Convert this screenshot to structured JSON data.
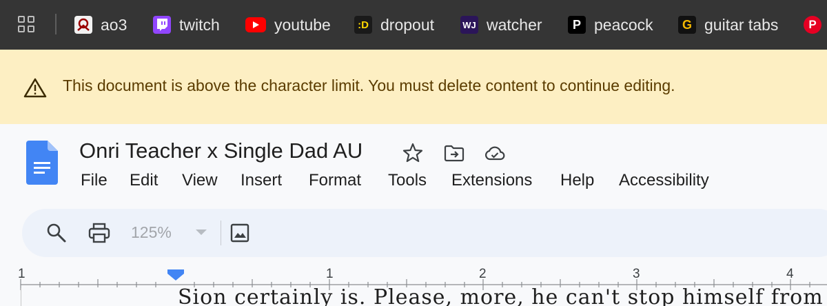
{
  "bookmarks": [
    {
      "label": "ao3",
      "icon": "ao3-icon",
      "color": "#990000"
    },
    {
      "label": "twitch",
      "icon": "twitch-icon",
      "color": "#9146ff"
    },
    {
      "label": "youtube",
      "icon": "youtube-icon",
      "color": "#ff0000"
    },
    {
      "label": "dropout",
      "icon": "dropout-icon",
      "color": "#1a1a1a",
      "glyph": ":D"
    },
    {
      "label": "watcher",
      "icon": "watcher-icon",
      "color": "#2b1559",
      "glyph": "WJ"
    },
    {
      "label": "peacock",
      "icon": "peacock-icon",
      "color": "#000000",
      "glyph": "P"
    },
    {
      "label": "guitar tabs",
      "icon": "guitar-tabs-icon",
      "color": "#111111",
      "glyph": "G"
    },
    {
      "label": "",
      "icon": "pinterest-icon",
      "color": "#e60023",
      "glyph": "P"
    }
  ],
  "banner": {
    "message": "This document is above the character limit. You must delete content to continue editing."
  },
  "document": {
    "title": "Onri Teacher x Single Dad AU"
  },
  "menu": [
    "File",
    "Edit",
    "View",
    "Insert",
    "Format",
    "Tools",
    "Extensions",
    "Help",
    "Accessibility"
  ],
  "toolbar": {
    "zoom": "125%"
  },
  "ruler": {
    "labels": [
      "1",
      "1",
      "2",
      "3",
      "4"
    ]
  },
  "page": {
    "snippet": "Sion certainly is.  Please, more,  he can't stop himself from"
  },
  "colors": {
    "bookmarks_bg": "#353535",
    "banner_bg": "#fdefc3",
    "toolbar_bg": "#edf2fa",
    "accent": "#4285f4"
  }
}
